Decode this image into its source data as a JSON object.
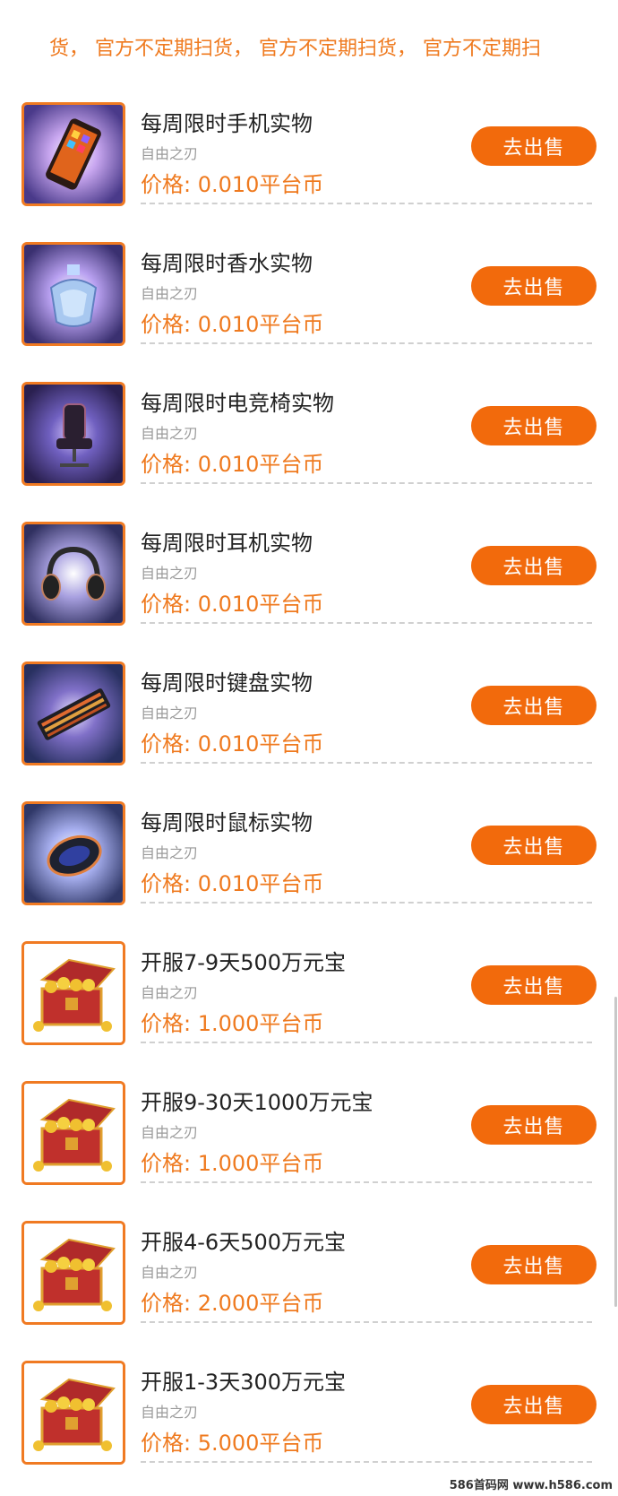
{
  "marquee": {
    "text": "货， 官方不定期扫货， 官方不定期扫货， 官方不定期扫"
  },
  "sell_label": "去出售",
  "items": [
    {
      "name": "每周限时手机实物",
      "seller": "自由之刃",
      "price": "价格: 0.010平台币",
      "icon": "phone-icon"
    },
    {
      "name": "每周限时香水实物",
      "seller": "自由之刃",
      "price": "价格: 0.010平台币",
      "icon": "perfume-icon"
    },
    {
      "name": "每周限时电竞椅实物",
      "seller": "自由之刃",
      "price": "价格: 0.010平台币",
      "icon": "gaming-chair-icon"
    },
    {
      "name": "每周限时耳机实物",
      "seller": "自由之刃",
      "price": "价格: 0.010平台币",
      "icon": "headphones-icon"
    },
    {
      "name": "每周限时键盘实物",
      "seller": "自由之刃",
      "price": "价格: 0.010平台币",
      "icon": "keyboard-icon"
    },
    {
      "name": "每周限时鼠标实物",
      "seller": "自由之刃",
      "price": "价格: 0.010平台币",
      "icon": "mouse-icon"
    },
    {
      "name": "开服7-9天500万元宝",
      "seller": "自由之刃",
      "price": "价格: 1.000平台币",
      "icon": "treasure-chest-icon"
    },
    {
      "name": "开服9-30天1000万元宝",
      "seller": "自由之刃",
      "price": "价格: 1.000平台币",
      "icon": "treasure-chest-icon"
    },
    {
      "name": "开服4-6天500万元宝",
      "seller": "自由之刃",
      "price": "价格: 2.000平台币",
      "icon": "treasure-chest-icon"
    },
    {
      "name": "开服1-3天300万元宝",
      "seller": "自由之刃",
      "price": "价格: 5.000平台币",
      "icon": "treasure-chest-icon"
    }
  ],
  "watermark": "586首码网 www.h586.com",
  "colors": {
    "accent": "#f26a0c",
    "price": "#ef7a1f",
    "border": "#f07a22"
  }
}
